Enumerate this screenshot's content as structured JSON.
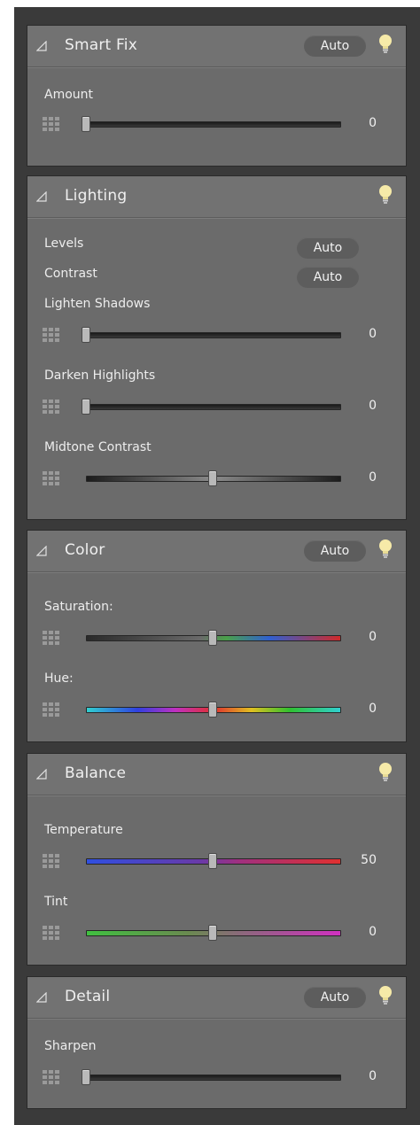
{
  "panels": {
    "smart_fix": {
      "title": "Smart Fix",
      "auto": "Auto",
      "amount": {
        "label": "Amount",
        "value": "0",
        "position": 0.0
      }
    },
    "lighting": {
      "title": "Lighting",
      "levels": {
        "label": "Levels",
        "auto": "Auto"
      },
      "contrast": {
        "label": "Contrast",
        "auto": "Auto"
      },
      "lighten_shadows": {
        "label": "Lighten Shadows",
        "value": "0",
        "position": 0.0
      },
      "darken_highlights": {
        "label": "Darken Highlights",
        "value": "0",
        "position": 0.0
      },
      "midtone_contrast": {
        "label": "Midtone Contrast",
        "value": "0",
        "position": 0.5
      }
    },
    "color": {
      "title": "Color",
      "auto": "Auto",
      "saturation": {
        "label": "Saturation:",
        "value": "0",
        "position": 0.5
      },
      "hue": {
        "label": "Hue:",
        "value": "0",
        "position": 0.5
      }
    },
    "balance": {
      "title": "Balance",
      "temperature": {
        "label": "Temperature",
        "value": "50",
        "position": 0.5
      },
      "tint": {
        "label": "Tint",
        "value": "0",
        "position": 0.5
      }
    },
    "detail": {
      "title": "Detail",
      "auto": "Auto",
      "sharpen": {
        "label": "Sharpen",
        "value": "0",
        "position": 0.0
      }
    }
  },
  "colors": {
    "panel_bg": "#6b6b6b",
    "header_bg": "#727272",
    "thumb": "#b9b9b9",
    "bulb": "#f5e6a0"
  }
}
